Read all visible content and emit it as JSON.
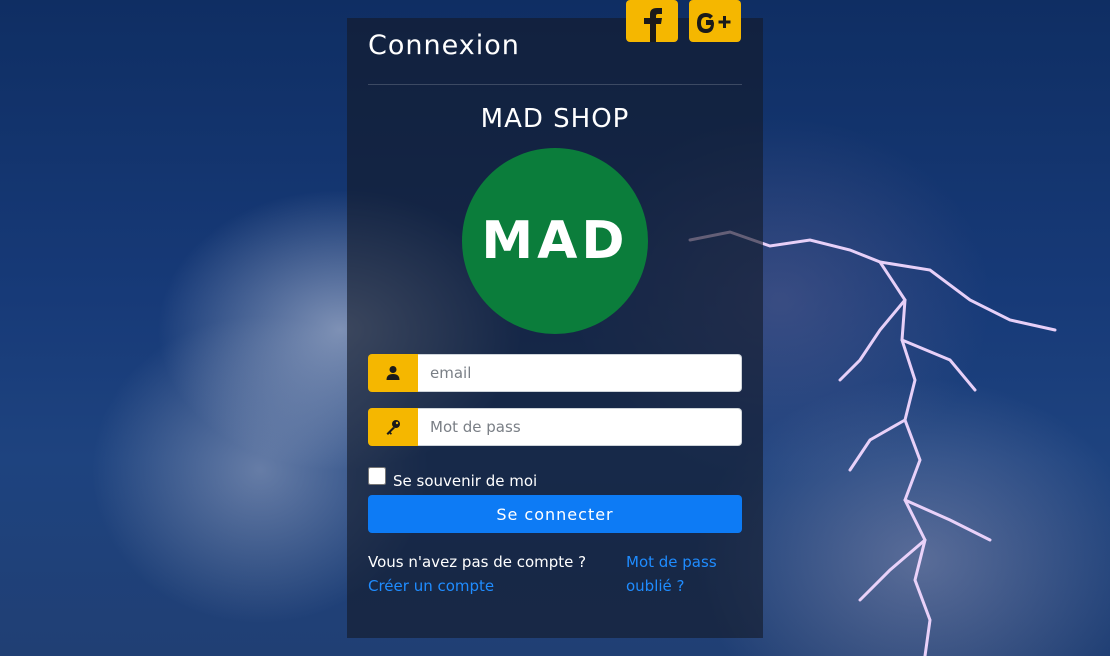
{
  "login": {
    "title": "Connexion",
    "shop_name": "MAD SHOP",
    "logo_text": "MAD",
    "email_placeholder": "email",
    "password_placeholder": "Mot de pass",
    "remember_label": "Se souvenir de moi",
    "submit_label": "Se connecter",
    "no_account_text": "Vous n'avez pas de compte ?",
    "create_account_link": "Créer un compte",
    "forgot_password_link": "Mot de pass oublié ?"
  },
  "social": {
    "facebook_icon": "facebook-icon",
    "google_plus_icon": "google-plus-icon"
  },
  "icons": {
    "email_addon": "user-icon",
    "password_addon": "key-icon"
  },
  "colors": {
    "accent_yellow": "#f5b700",
    "button_blue": "#0d7bf5",
    "link_blue": "#1f8cff",
    "logo_green": "#0b7d3b"
  }
}
